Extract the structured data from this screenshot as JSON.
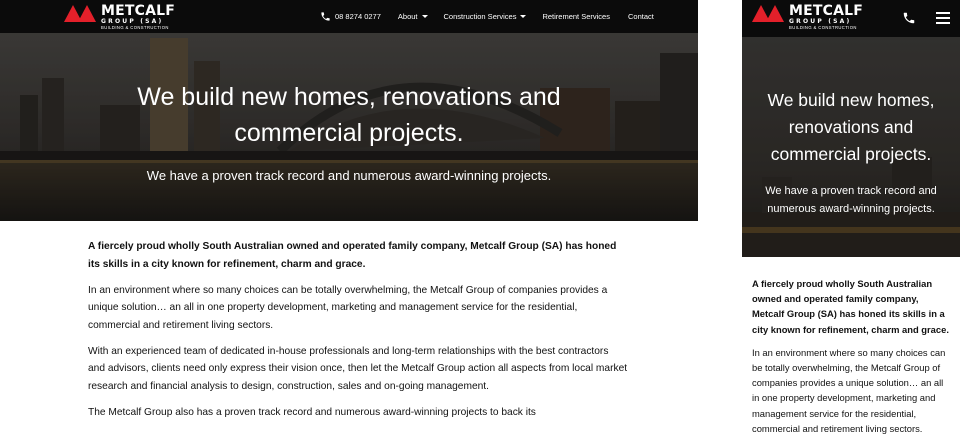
{
  "brand": {
    "name": "METCALF",
    "group": "GROUP (SA)",
    "tagline": "BUILDING & CONSTRUCTION",
    "accent": "#e3202a"
  },
  "nav": {
    "phone": "08 8274 0277",
    "items": [
      {
        "label": "About",
        "dropdown": true
      },
      {
        "label": "Construction Services",
        "dropdown": true
      },
      {
        "label": "Retirement Services",
        "dropdown": false
      },
      {
        "label": "Contact",
        "dropdown": false
      }
    ],
    "mobile_icons": [
      "phone-icon",
      "hamburger-menu-icon"
    ]
  },
  "hero": {
    "headline": "We build new homes, renovations and commercial projects.",
    "subline": "We have a proven track record and numerous award-winning projects."
  },
  "body": {
    "lead": "A fiercely proud wholly South Australian owned and operated family company, Metcalf Group (SA) has honed its skills in a city known for refinement, charm and grace.",
    "p1": "In an environment where so many choices can be totally overwhelming, the Metcalf Group of companies provides a unique solution… an all in one property development, marketing and management service for the residential, commercial and retirement living sectors.",
    "p2": "With an experienced team of dedicated in-house professionals and long-term relationships with the best contractors and advisors, clients need only express their vision once, then let the Metcalf Group action all aspects from local market research and financial analysis to design, construction, sales and on-going management.",
    "p3": "The Metcalf Group also has a proven track record and numerous award-winning projects to back its"
  },
  "colors": {
    "nav_bg": "#0b0b0b",
    "text": "#111111",
    "hero_text": "#ffffff"
  }
}
